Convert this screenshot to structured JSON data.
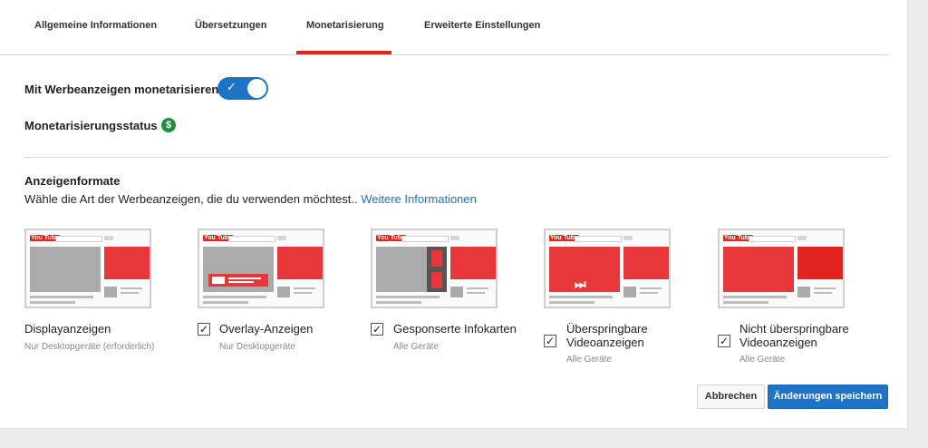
{
  "tabs": [
    {
      "label": "Allgemeine Informationen"
    },
    {
      "label": "Übersetzungen"
    },
    {
      "label": "Monetarisierung"
    },
    {
      "label": "Erweiterte Einstellungen"
    }
  ],
  "active_tab": "Monetarisierung",
  "monetize": {
    "label": "Mit Werbeanzeigen monetarisieren",
    "enabled": true,
    "check_glyph": "✓"
  },
  "status": {
    "label": "Monetarisierungsstatus",
    "icon": "dollar-icon",
    "icon_glyph": "$",
    "icon_color": "#1e8e3e"
  },
  "ad_formats": {
    "title": "Anzeigenformate",
    "description": "Wähle die Art der Werbeanzeigen, die du verwenden möchtest..",
    "link": "Weitere Informationen",
    "items": [
      {
        "label": "Displayanzeigen",
        "sub": "Nur Desktopgeräte (erforderlich)",
        "checked": null
      },
      {
        "label": "Overlay-Anzeigen",
        "sub": "Nur Desktopgeräte",
        "checked": true
      },
      {
        "label": "Gesponserte Infokarten",
        "sub": "Alle Geräte",
        "checked": true
      },
      {
        "label": "Überspringbare Videoanzeigen",
        "sub": "Alle Geräte",
        "checked": true
      },
      {
        "label": "Nicht überspringbare Videoanzeigen",
        "sub": "Alle Geräte",
        "checked": true
      }
    ],
    "thumb_logo": "You",
    "thumb_logo_red": "Tube",
    "skip_glyph": "⏭",
    "check_glyph": "✓"
  },
  "buttons": {
    "cancel": "Abbrechen",
    "save": "Änderungen speichern"
  },
  "colors": {
    "accent": "#1e73c7",
    "tab_underline": "#e62117",
    "ad_red": "#e8373a"
  }
}
